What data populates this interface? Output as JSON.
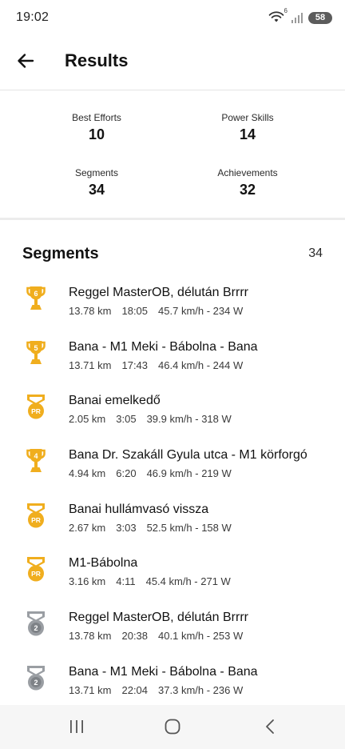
{
  "status_bar": {
    "time": "19:02",
    "battery": "58",
    "wifi_badge": "6"
  },
  "header": {
    "title": "Results",
    "back_icon": "arrow-left-icon"
  },
  "summary": {
    "best_efforts": {
      "label": "Best Efforts",
      "value": "10"
    },
    "power_skills": {
      "label": "Power Skills",
      "value": "14"
    },
    "segments": {
      "label": "Segments",
      "value": "34"
    },
    "achievements": {
      "label": "Achievements",
      "value": "32"
    }
  },
  "segments_section": {
    "title": "Segments",
    "count": "34",
    "items": [
      {
        "icon": "trophy-icon",
        "rank": "6",
        "title": "Reggel MasterOB, délután Brrrr",
        "distance": "13.78 km",
        "time": "18:05",
        "speed_power": "45.7 km/h - 234 W"
      },
      {
        "icon": "trophy-icon",
        "rank": "5",
        "title": "Bana - M1 Meki - Bábolna - Bana",
        "distance": "13.71 km",
        "time": "17:43",
        "speed_power": "46.4 km/h - 244 W"
      },
      {
        "icon": "pr-medal-icon",
        "rank": "PR",
        "title": "Banai emelkedő",
        "distance": "2.05 km",
        "time": "3:05",
        "speed_power": "39.9 km/h - 318 W"
      },
      {
        "icon": "trophy-icon",
        "rank": "4",
        "title": "Bana Dr. Szakáll Gyula utca - M1 körforgó",
        "distance": "4.94 km",
        "time": "6:20",
        "speed_power": "46.9 km/h - 219 W"
      },
      {
        "icon": "pr-medal-icon",
        "rank": "PR",
        "title": "Banai hullámvasó vissza",
        "distance": "2.67 km",
        "time": "3:03",
        "speed_power": "52.5 km/h - 158 W"
      },
      {
        "icon": "pr-medal-icon",
        "rank": "PR",
        "title": "M1-Bábolna",
        "distance": "3.16 km",
        "time": "4:11",
        "speed_power": "45.4 km/h - 271 W"
      },
      {
        "icon": "silver-medal-icon",
        "rank": "2",
        "title": "Reggel MasterOB, délután Brrrr",
        "distance": "13.78 km",
        "time": "20:38",
        "speed_power": "40.1 km/h - 253 W"
      },
      {
        "icon": "silver-medal-icon",
        "rank": "2",
        "title": "Bana - M1 Meki - Bábolna - Bana",
        "distance": "13.71 km",
        "time": "22:04",
        "speed_power": "37.3 km/h - 236 W"
      }
    ]
  },
  "colors": {
    "gold": "#F0AE1E",
    "gold_dark": "#D9950F",
    "silver": "#9A9EA3",
    "silver_dark": "#7E8287",
    "text": "#121212"
  },
  "nav_bar": {
    "icons": [
      "recent-apps-icon",
      "home-icon",
      "back-nav-icon"
    ]
  }
}
